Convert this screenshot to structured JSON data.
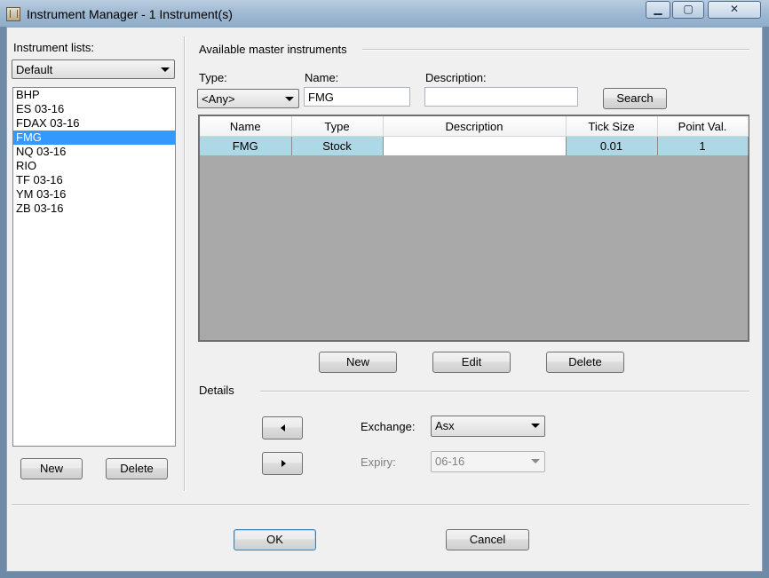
{
  "window": {
    "title": "Instrument Manager - 1 Instrument(s)",
    "minimize_glyph": "▁",
    "maximize_glyph": "▢",
    "close_glyph": "✕"
  },
  "instrument_lists": {
    "label": "Instrument lists:",
    "selected_list": "Default",
    "items": [
      "BHP",
      "ES 03-16",
      "FDAX 03-16",
      "FMG",
      "NQ 03-16",
      "RIO",
      "TF 03-16",
      "YM 03-16",
      "ZB 03-16"
    ],
    "selected_item": "FMG",
    "new_label": "New",
    "delete_label": "Delete"
  },
  "master": {
    "group_label": "Available master instruments",
    "type_label": "Type:",
    "type_value": "<Any>",
    "name_label": "Name:",
    "name_value": "FMG",
    "description_label": "Description:",
    "description_value": "",
    "search_label": "Search",
    "columns": [
      "Name",
      "Type",
      "Description",
      "Tick Size",
      "Point Val."
    ],
    "rows": [
      {
        "name": "FMG",
        "type": "Stock",
        "description": "",
        "tick_size": "0.01",
        "point_value": "1"
      }
    ],
    "new_label": "New",
    "edit_label": "Edit",
    "delete_label": "Delete"
  },
  "details": {
    "group_label": "Details",
    "exchange_label": "Exchange:",
    "exchange_value": "Asx",
    "expiry_label": "Expiry:",
    "expiry_value": "06-16"
  },
  "footer": {
    "ok_label": "OK",
    "cancel_label": "Cancel"
  },
  "colors": {
    "selection": "#3399ff",
    "grid_row": "#add8e6",
    "grid_empty": "#a9a9a9"
  }
}
